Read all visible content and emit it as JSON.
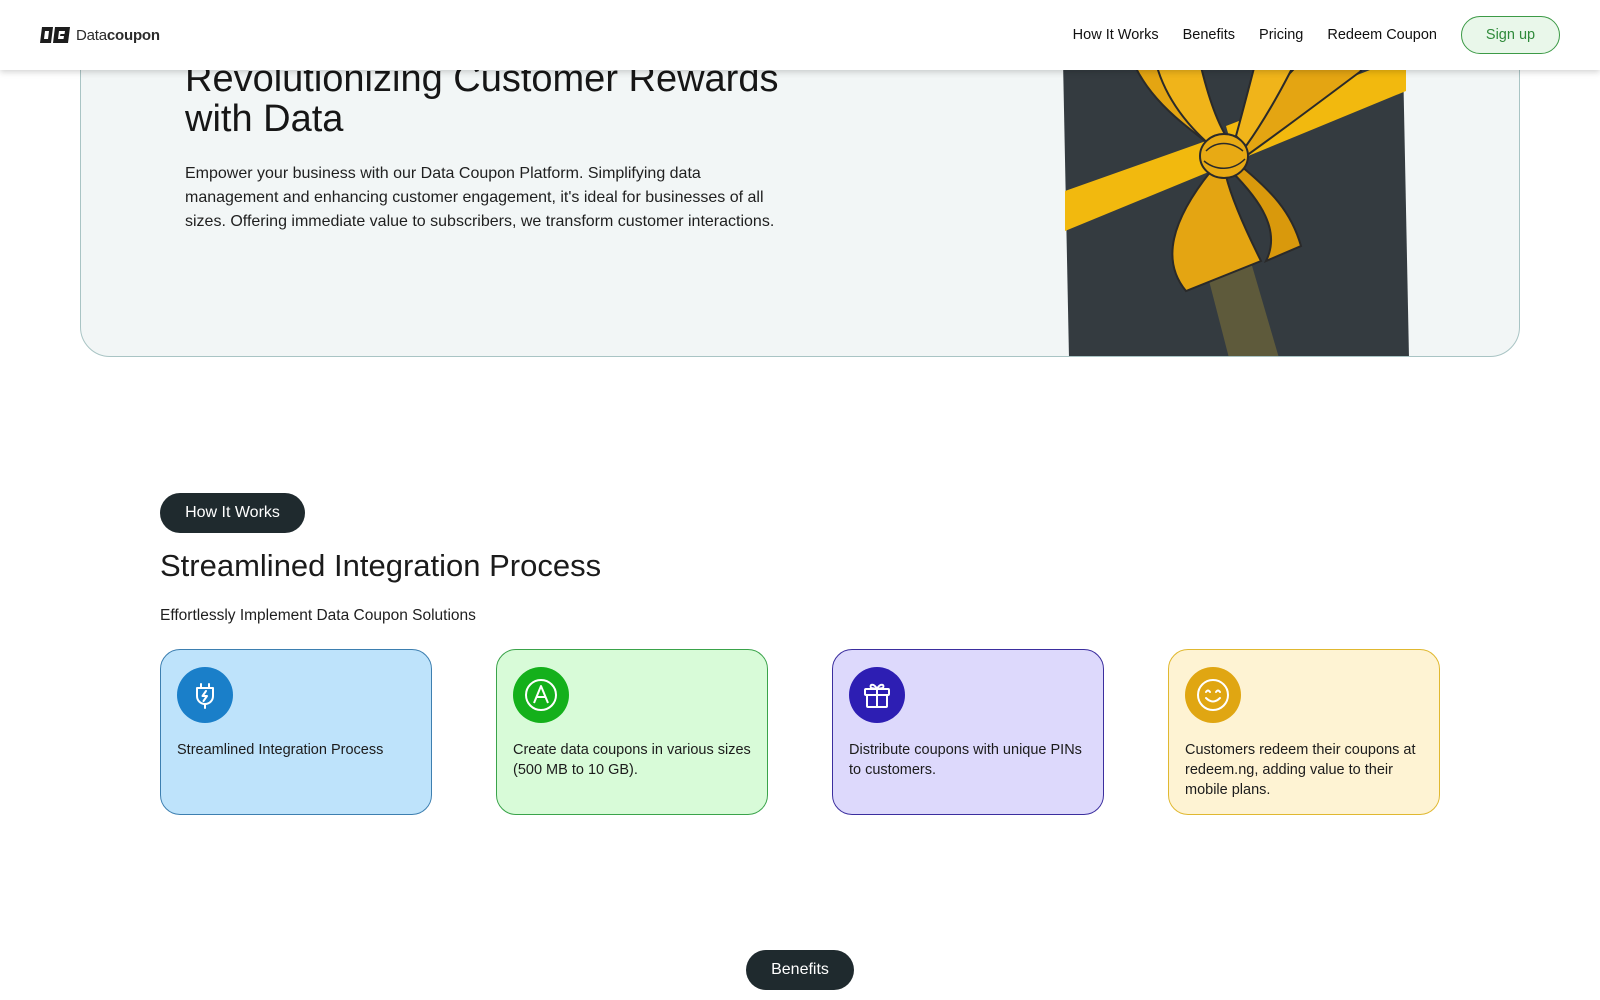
{
  "brand": {
    "name_light": "Data",
    "name_bold": "coupon"
  },
  "nav": {
    "links": [
      "How It Works",
      "Benefits",
      "Pricing",
      "Redeem Coupon"
    ],
    "signup": "Sign up"
  },
  "hero": {
    "title": "Revolutionizing Customer Rewards with Data",
    "description": "Empower your business with our Data Coupon Platform. Simplifying data management and enhancing customer engagement, it's ideal for businesses of all sizes. Offering immediate value to subscribers, we transform customer interactions."
  },
  "how_it_works": {
    "tag": "How It Works",
    "title": "Streamlined Integration Process",
    "subtitle": "Effortlessly Implement Data Coupon Solutions",
    "cards": [
      {
        "text": "Streamlined Integration Process",
        "icon": "plug-icon",
        "bg": "#bee3fb",
        "border": "#3d7fb0",
        "icon_bg": "#1a7fc9"
      },
      {
        "text": "Create data coupons in various sizes (500 MB to 10 GB).",
        "icon": "coupon-a-icon",
        "bg": "#d8fbd8",
        "border": "#3aa34a",
        "icon_bg": "#14b01b"
      },
      {
        "text": "Distribute coupons with unique PINs to customers.",
        "icon": "gift-icon",
        "bg": "#ddd9fc",
        "border": "#3b2e9e",
        "icon_bg": "#2d1eb3"
      },
      {
        "text": "Customers redeem their coupons at redeem.ng, adding value to their mobile plans.",
        "icon": "smile-icon",
        "bg": "#fef3d3",
        "border": "#e0b830",
        "icon_bg": "#e0a612"
      }
    ]
  },
  "benefits": {
    "tag": "Benefits"
  }
}
